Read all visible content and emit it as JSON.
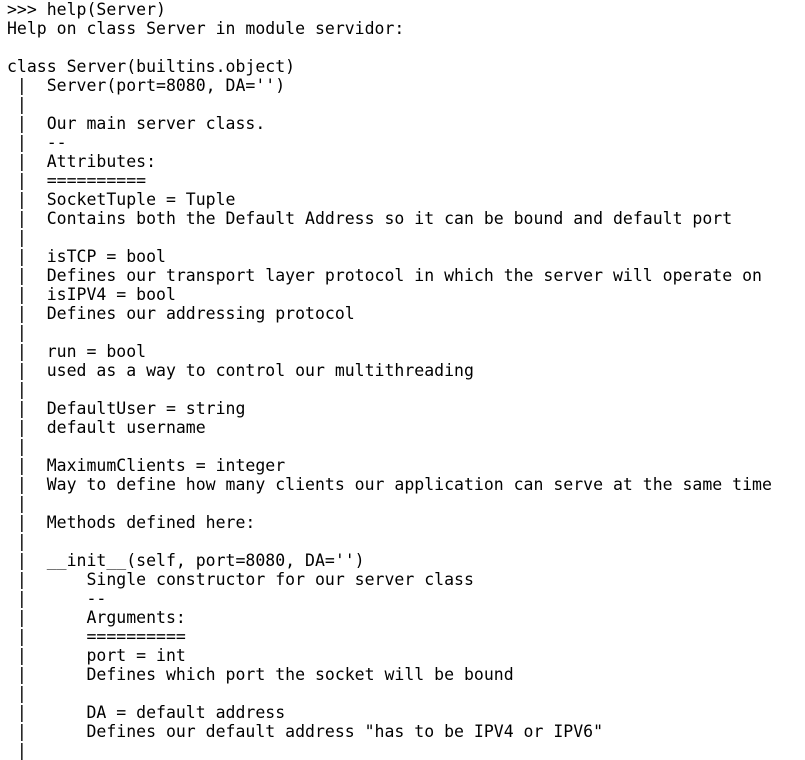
{
  "terminal": {
    "lines": [
      ">>> help(Server)",
      "Help on class Server in module servidor:",
      "",
      "class Server(builtins.object)",
      " |  Server(port=8080, DA='')",
      " |",
      " |  Our main server class.",
      " |  --",
      " |  Attributes:",
      " |  ==========",
      " |  SocketTuple = Tuple",
      " |  Contains both the Default Address so it can be bound and default port",
      " |",
      " |  isTCP = bool",
      " |  Defines our transport layer protocol in which the server will operate on",
      " |  isIPV4 = bool",
      " |  Defines our addressing protocol",
      " |",
      " |  run = bool",
      " |  used as a way to control our multithreading",
      " |",
      " |  DefaultUser = string",
      " |  default username",
      " |",
      " |  MaximumClients = integer",
      " |  Way to define how many clients our application can serve at the same time",
      " |",
      " |  Methods defined here:",
      " |",
      " |  __init__(self, port=8080, DA='')",
      " |      Single constructor for our server class",
      " |      --",
      " |      Arguments:",
      " |      ==========",
      " |      port = int",
      " |      Defines which port the socket will be bound",
      " |",
      " |      DA = default address",
      " |      Defines our default address \"has to be IPV4 or IPV6\"",
      " |"
    ]
  }
}
